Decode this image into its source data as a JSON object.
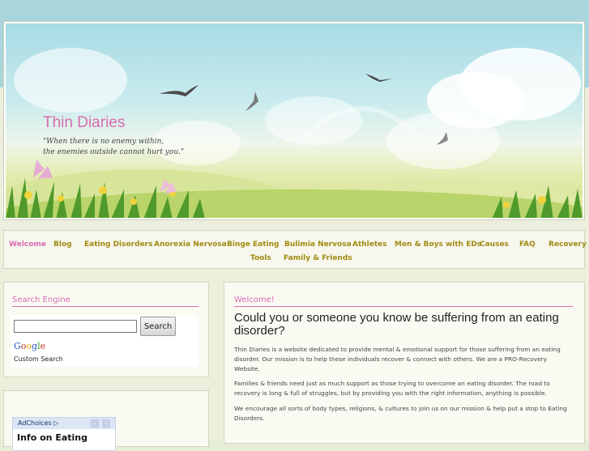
{
  "header": {
    "site_title": "Thin Diaries",
    "tagline_line1": "\"When there is no enemy within,",
    "tagline_line2": "the enemies outside cannot hurt you.\""
  },
  "nav": {
    "items": [
      "Welcome",
      "Blog",
      "Eating Disorders",
      "Anorexia Nervosa",
      "Binge Eating",
      "Bulimia Nervosa",
      "Athletes",
      "Men & Boys with EDs",
      "Causes",
      "FAQ",
      "Recovery",
      "Tools",
      "Family & Friends"
    ],
    "active": "Welcome"
  },
  "sidebar": {
    "search_title": "Search Engine",
    "search_button": "Search",
    "google_label": "Google",
    "custom_search": "Custom Search",
    "adchoices": "AdChoices",
    "ad_text": "Info on Eating"
  },
  "main": {
    "label": "Welcome!",
    "heading": "Could you or someone you know be suffering from an eating disorder?",
    "paragraphs": [
      "Thin Diaries is a website dedicated to provide mental & emotional support for those suffering from an eating disorder. Our mission is to help these individuals recover & connect with others. We are a PRO-Recovery Website.",
      "Families & friends need just as much support as those trying to overcome an eating disorder. The road to recovery is long & full of struggles, but by providing you with the right information, anything is possible.",
      "We encourage all sorts of body types, religions, & cultures to join us on our mission & help put a stop to Eating Disorders."
    ]
  },
  "colors": {
    "accent_pink": "#d86cb1",
    "nav_gold": "#a08a12",
    "sky": "#a8d6dc"
  }
}
